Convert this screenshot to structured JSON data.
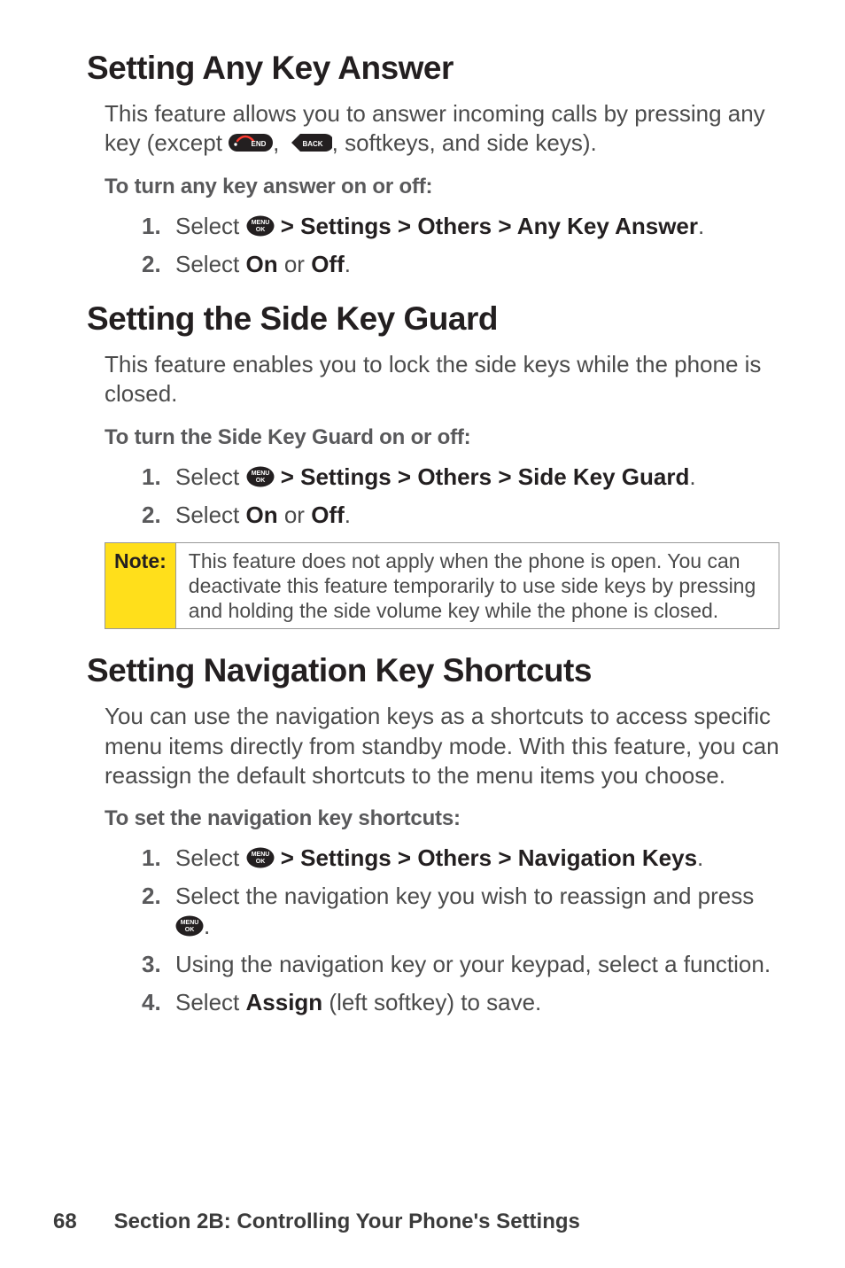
{
  "icons": {
    "menu_alt": "MENU/OK key",
    "end_alt": "END key",
    "back_alt": "BACK key"
  },
  "s1": {
    "heading": "Setting Any Key Answer",
    "p1a": "This feature allows you to answer incoming calls by pressing any key (except ",
    "p1b": ", ",
    "p1c": ", softkeys, and side keys).",
    "lead": "To turn any key answer on or off:",
    "li1_a": "Select ",
    "li1_b": " > Settings > Others > Any Key Answer",
    "li1_c": ".",
    "li2_a": "Select ",
    "li2_b": "On",
    "li2_c": " or ",
    "li2_d": "Off",
    "li2_e": "."
  },
  "s2": {
    "heading": "Setting the Side Key Guard",
    "p1": "This feature enables you to lock the side keys while the phone is closed.",
    "lead": "To turn the Side Key Guard on or off:",
    "li1_a": "Select ",
    "li1_b": " > Settings > Others > Side Key Guard",
    "li1_c": ".",
    "li2_a": "Select ",
    "li2_b": "On",
    "li2_c": " or ",
    "li2_d": "Off",
    "li2_e": "."
  },
  "note": {
    "tag": "Note:",
    "msg": "This feature does not apply when the phone is open. You can deactivate this feature temporarily to use side keys by pressing and holding the side volume key while the phone is closed."
  },
  "s3": {
    "heading": "Setting Navigation Key Shortcuts",
    "p1": "You can use the navigation keys as a shortcuts to access specific menu items directly from standby mode. With this feature, you can reassign the default shortcuts to the menu items you choose.",
    "lead": "To set the navigation key shortcuts:",
    "li1_a": "Select ",
    "li1_b": " > Settings > Others > Navigation Keys",
    "li1_c": ".",
    "li2_a": "Select the navigation key you wish to reassign and press ",
    "li2_b": ".",
    "li3": "Using the navigation key or your keypad, select a function.",
    "li4_a": "Select ",
    "li4_b": "Assign",
    "li4_c": " (left softkey) to save."
  },
  "footer": {
    "page": "68",
    "title": "Section 2B: Controlling Your Phone's Settings"
  },
  "nums": {
    "one": "1.",
    "two": "2.",
    "three": "3.",
    "four": "4."
  }
}
